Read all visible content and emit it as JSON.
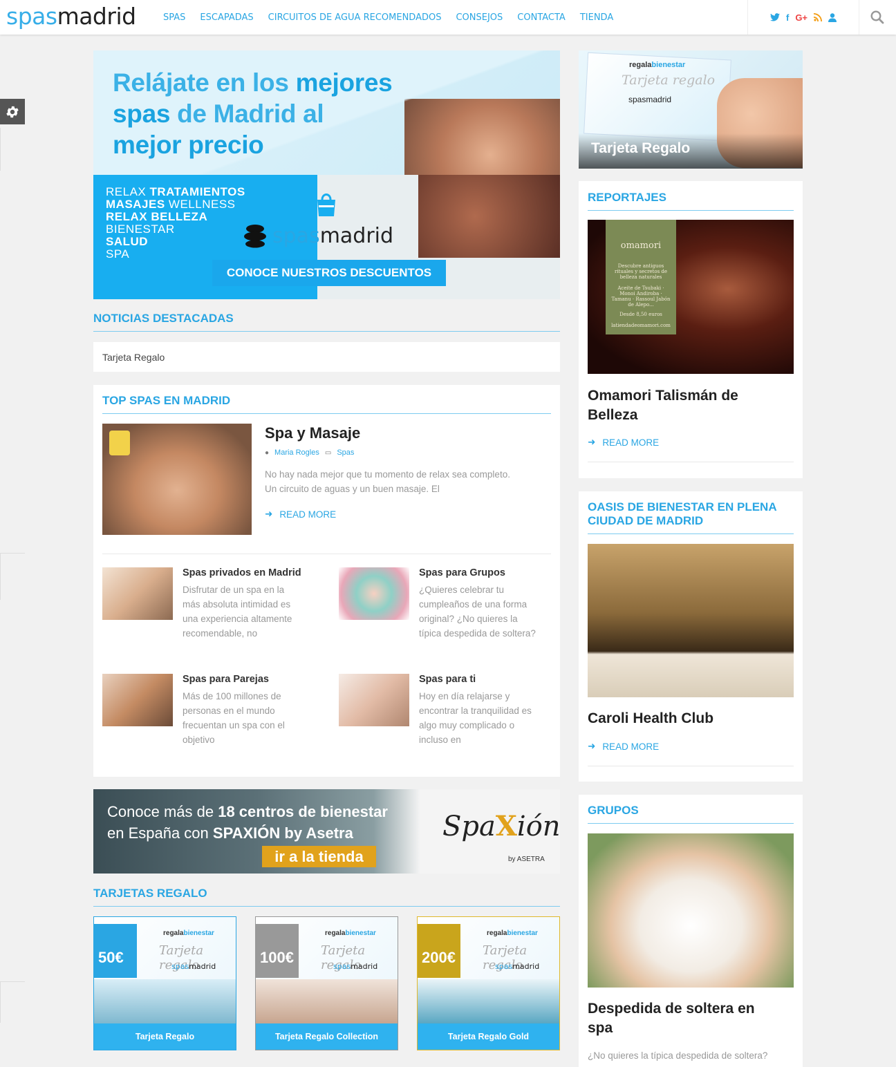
{
  "header": {
    "logo_a": "spas",
    "logo_b": "madrid",
    "nav": [
      "SPAS",
      "ESCAPADAS",
      "CIRCUITOS DE AGUA RECOMENDADOS",
      "CONSEJOS",
      "CONTACTA",
      "TIENDA"
    ],
    "social": {
      "twitter": "🐦",
      "facebook": "f",
      "google": "G+",
      "rss": "≡",
      "user": "●"
    }
  },
  "hero": {
    "line1_a": "Relájate en los ",
    "line1_b": "mejores",
    "line2_a": "spas",
    "line2_b": " de Madrid al",
    "line3": "mejor precio",
    "words": [
      {
        "a": "RELAX ",
        "b": "TRATAMIENTOS"
      },
      {
        "a": "",
        "b": "MASAJES",
        "c": " WELLNESS"
      },
      {
        "a": "",
        "b": "RELAX BELLEZA"
      },
      {
        "a": "BIENESTAR",
        "b": ""
      },
      {
        "a": "",
        "b": "SALUD"
      },
      {
        "a": "SPA",
        "b": ""
      }
    ],
    "brand_a": "spas",
    "brand_b": "madrid",
    "cta": "CONOCE NUESTROS DESCUENTOS"
  },
  "noticias": {
    "heading": "NOTICIAS DESTACADAS",
    "item": "Tarjeta Regalo"
  },
  "top_spas": {
    "heading": "TOP SPAS EN MADRID",
    "featured": {
      "title": "Spa y Masaje",
      "author": "Maria Rogles",
      "category": "Spas",
      "excerpt_1": "No hay nada mejor que tu momento de relax sea completo.",
      "excerpt_2": "Un circuito de aguas y un buen masaje. El",
      "read_more": "READ MORE"
    },
    "items": [
      {
        "title": "Spas privados en Madrid",
        "lines": [
          "Disfrutar de un spa en la",
          "más absoluta intimidad es",
          "una experiencia altamente",
          "recomendable, no"
        ]
      },
      {
        "title": "Spas para Grupos",
        "lines": [
          "¿Quieres celebrar tu",
          "cumpleaños de una forma",
          "original? ¿No quieres la",
          "típica despedida de soltera?"
        ]
      },
      {
        "title": "Spas para Parejas",
        "lines": [
          "Más de 100 millones de",
          "personas en el mundo",
          "frecuentan un spa con el",
          "objetivo"
        ]
      },
      {
        "title": "Spas para ti",
        "lines": [
          "Hoy en día relajarse y",
          "encontrar la tranquilidad es",
          "algo muy complicado o",
          "incluso en"
        ]
      }
    ]
  },
  "spaxion": {
    "line1_a": "Conoce más de ",
    "line1_b": "18 centros de bienestar",
    "line2_a": "en España con ",
    "line2_b": "SPAXIÓN by Asetra",
    "go": "ir a la tienda",
    "logo_a": "Spa",
    "logo_x": "X",
    "logo_b": "ión",
    "by": "by ASETRA"
  },
  "tarjetas": {
    "heading": "TARJETAS REGALO",
    "rb_a": "regala",
    "rb_b": "bienestar",
    "script": "Tarjeta regalo",
    "sm_a": "spas",
    "sm_b": "madrid",
    "cards": [
      {
        "price": "50€",
        "label": "Tarjeta Regalo"
      },
      {
        "price": "100€",
        "label": "Tarjeta Regalo Collection"
      },
      {
        "price": "200€",
        "label": "Tarjeta Regalo Gold"
      }
    ]
  },
  "sidebar": {
    "gift": {
      "caption": "Tarjeta Regalo",
      "rb_a": "regala",
      "rb_b": "bienestar",
      "script": "Tarjeta regalo",
      "sm": "spasmadrid"
    },
    "reportajes": {
      "heading": "REPORTAJES",
      "omamori_name": "omamori",
      "omamori_sub": "TALISMÁN DE BELLEZA",
      "omamori_text": "Descubre antiguos rituales y secretos de belleza naturales",
      "omamori_list": "Aceite de Tsubaki · Monoi Andiroba · Tamanu · Rassoul Jabón de Alepo...",
      "omamori_price": "Desde 8,50 euros",
      "omamori_site": "latiendadeomamori.com",
      "title_1": "Omamori Talismán de",
      "title_2": "Belleza",
      "read_more": "READ MORE"
    },
    "oasis": {
      "heading_1": "OASIS DE BIENESTAR EN PLENA",
      "heading_2": "CIUDAD DE MADRID",
      "title": "Caroli Health Club",
      "read_more": "READ MORE"
    },
    "grupos": {
      "heading": "GRUPOS",
      "title_1": "Despedida de soltera en",
      "title_2": "spa",
      "excerpt": "¿No quieres la típica despedida de soltera?"
    }
  }
}
